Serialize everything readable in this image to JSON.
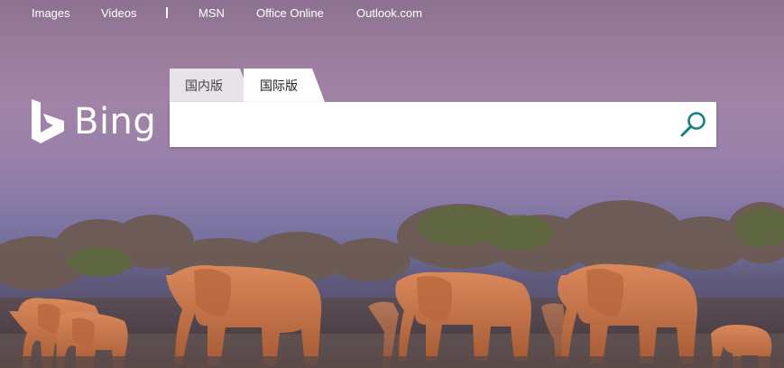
{
  "nav": {
    "images": "Images",
    "videos": "Videos",
    "msn": "MSN",
    "office_online": "Office Online",
    "outlook": "Outlook.com"
  },
  "logo": {
    "text": "Bing",
    "icon": "bing-logo-icon"
  },
  "tabs": [
    {
      "label": "国内版",
      "active": false
    },
    {
      "label": "国际版",
      "active": true
    }
  ],
  "search": {
    "value": "",
    "button_icon": "search-icon"
  },
  "colors": {
    "search_icon": "#0c8484",
    "sky_top": "#8c7290",
    "sky_mid": "#9a81aa",
    "ground": "#4b4552",
    "elephant": "#c9784a"
  }
}
